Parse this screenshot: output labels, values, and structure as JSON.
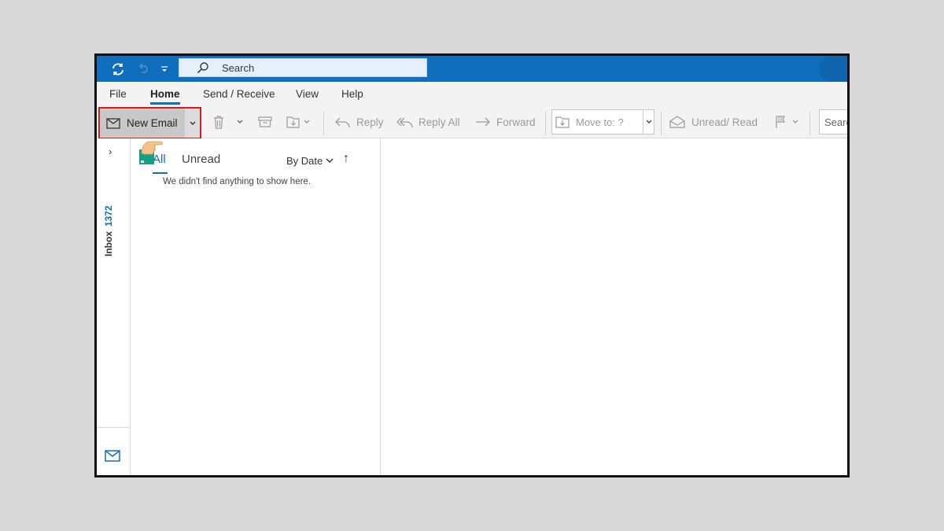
{
  "search": {
    "placeholder": "Search"
  },
  "tabs": [
    {
      "label": "File"
    },
    {
      "label": "Home"
    },
    {
      "label": "Send / Receive"
    },
    {
      "label": "View"
    },
    {
      "label": "Help"
    }
  ],
  "ribbon": {
    "new_email": "New Email",
    "reply": "Reply",
    "reply_all": "Reply All",
    "forward": "Forward",
    "move_to": "Move to: ?",
    "unread_read": "Unread/ Read",
    "search_people": "Search"
  },
  "rail": {
    "folder": "Inbox",
    "count": "1372"
  },
  "list": {
    "filter_all": "All",
    "filter_unread": "Unread",
    "sort": "By Date",
    "empty_message": "We didn't find anything to show here."
  },
  "colors": {
    "accent": "#106ebe",
    "highlight": "#d11f1f"
  }
}
